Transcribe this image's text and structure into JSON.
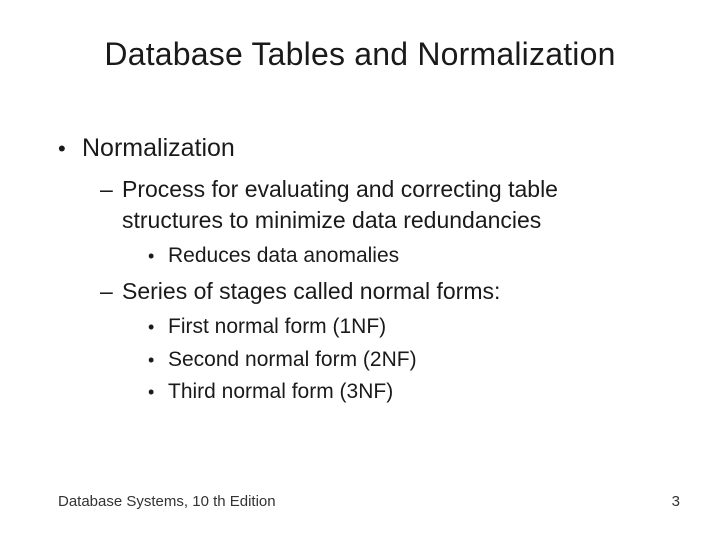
{
  "title": "Database Tables and Normalization",
  "bullets": {
    "b1": "Normalization",
    "b1_1": "Process for evaluating and correcting table structures to minimize data redundancies",
    "b1_1_1": "Reduces data anomalies",
    "b1_2": "Series of stages called normal forms:",
    "b1_2_1": "First normal form (1NF)",
    "b1_2_2": "Second normal form (2NF)",
    "b1_2_3": "Third normal form (3NF)"
  },
  "footer": {
    "source": "Database Systems, 10 th Edition",
    "page": "3"
  }
}
